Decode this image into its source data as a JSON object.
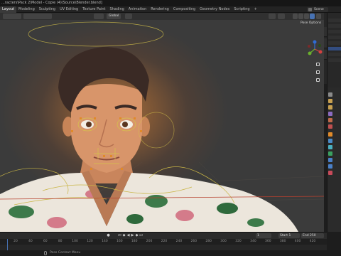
{
  "window": {
    "title": "...racters\\Pack 2\\Model - Copie (4)\\Source\\Blender.blend]"
  },
  "workspace_tabs": [
    {
      "label": "Layout",
      "active": true
    },
    {
      "label": "Modeling",
      "active": false
    },
    {
      "label": "Sculpting",
      "active": false
    },
    {
      "label": "UV Editing",
      "active": false
    },
    {
      "label": "Texture Paint",
      "active": false
    },
    {
      "label": "Shading",
      "active": false
    },
    {
      "label": "Animation",
      "active": false
    },
    {
      "label": "Rendering",
      "active": false
    },
    {
      "label": "Compositing",
      "active": false
    },
    {
      "label": "Geometry Nodes",
      "active": false
    },
    {
      "label": "Scripting",
      "active": false
    },
    {
      "label": "+",
      "active": false
    }
  ],
  "scene": {
    "label": "Scene"
  },
  "viewport": {
    "transform_orientation": "Global",
    "pose_options": "Pose Options",
    "sidebar_tabs": [
      "Item",
      "Tool",
      "View"
    ],
    "gizmo_axes": [
      "X",
      "Y",
      "Z"
    ]
  },
  "timeline": {
    "start_label": "Start",
    "start_value": "1",
    "end_label": "End",
    "end_value": "250",
    "current_frame": "1",
    "ruler": [
      "20",
      "40",
      "60",
      "80",
      "100",
      "120",
      "140",
      "160",
      "180",
      "200",
      "220",
      "240",
      "260",
      "280",
      "300",
      "320",
      "340",
      "360",
      "380",
      "400",
      "420"
    ]
  },
  "statusbar": {
    "hint": "Pose Context Menu"
  },
  "colors": {
    "accent": "#4772b3",
    "bone_yellow": "#d6c34a",
    "bone_orange": "#e08a2a"
  }
}
